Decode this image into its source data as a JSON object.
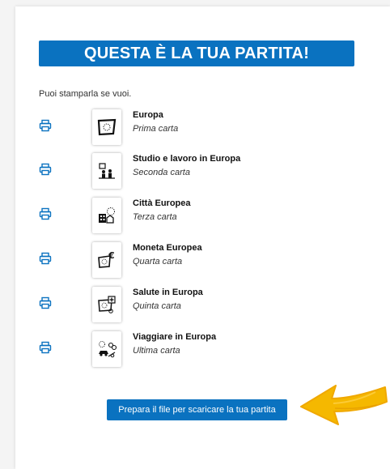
{
  "banner": {
    "title": "QUESTA È LA TUA PARTITA!"
  },
  "intro": "Puoi stamparla se vuoi.",
  "cards": [
    {
      "title": "Europa",
      "subtitle": "Prima carta",
      "icon": "eu-flag-icon"
    },
    {
      "title": "Studio e lavoro in Europa",
      "subtitle": "Seconda carta",
      "icon": "study-work-icon"
    },
    {
      "title": "Città Europea",
      "subtitle": "Terza carta",
      "icon": "city-icon"
    },
    {
      "title": "Moneta Europea",
      "subtitle": "Quarta carta",
      "icon": "euro-icon"
    },
    {
      "title": "Salute in Europa",
      "subtitle": "Quinta carta",
      "icon": "health-icon"
    },
    {
      "title": "Viaggiare in Europa",
      "subtitle": "Ultima carta",
      "icon": "travel-icon"
    }
  ],
  "cta_label": "Prepara il file per scaricare la tua partita",
  "colors": {
    "primary": "#0a72c0",
    "arrow": "#f5b800"
  }
}
